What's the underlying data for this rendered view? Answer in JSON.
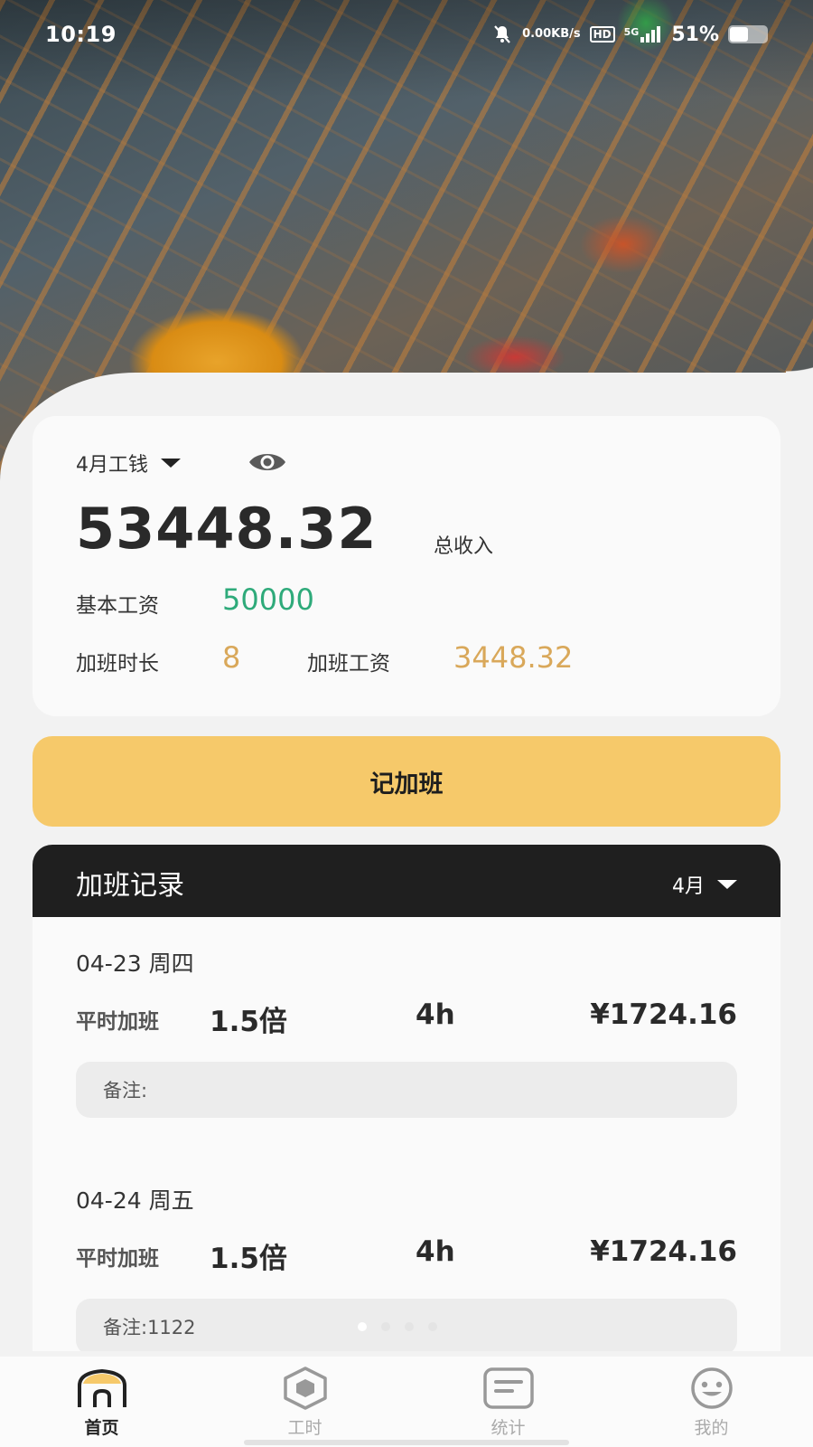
{
  "status_bar": {
    "time": "10:19",
    "net_speed_value": "0.00",
    "net_speed_unit": "KB/s",
    "hd": "HD",
    "network": "5G",
    "battery": "51%",
    "battery_level": 0.51
  },
  "summary": {
    "month_label": "4月工钱",
    "total_amount": "53448.32",
    "total_label": "总收入",
    "base_salary_label": "基本工资",
    "base_salary_value": "50000",
    "ot_hours_label": "加班时长",
    "ot_hours_value": "8",
    "ot_pay_label": "加班工资",
    "ot_pay_value": "3448.32"
  },
  "record_button": "记加班",
  "records": {
    "title": "加班记录",
    "month": "4月",
    "items": [
      {
        "date": "04-23 周四",
        "type": "平时加班",
        "multiplier": "1.5倍",
        "hours": "4h",
        "amount": "¥1724.16",
        "note": "备注:"
      },
      {
        "date": "04-24 周五",
        "type": "平时加班",
        "multiplier": "1.5倍",
        "hours": "4h",
        "amount": "¥1724.16",
        "note": "备注:1122"
      }
    ]
  },
  "bottom_nav": [
    {
      "label": "首页",
      "icon": "home-icon",
      "active": true
    },
    {
      "label": "工时",
      "icon": "hexagon-icon",
      "active": false
    },
    {
      "label": "统计",
      "icon": "stats-card-icon",
      "active": false
    },
    {
      "label": "我的",
      "icon": "smiley-face-icon",
      "active": false
    }
  ],
  "colors": {
    "accent_yellow": "#f6c96a",
    "green_value": "#2eaa7a",
    "gold_value": "#d9a85a",
    "header_dark": "#1f1f1f"
  }
}
